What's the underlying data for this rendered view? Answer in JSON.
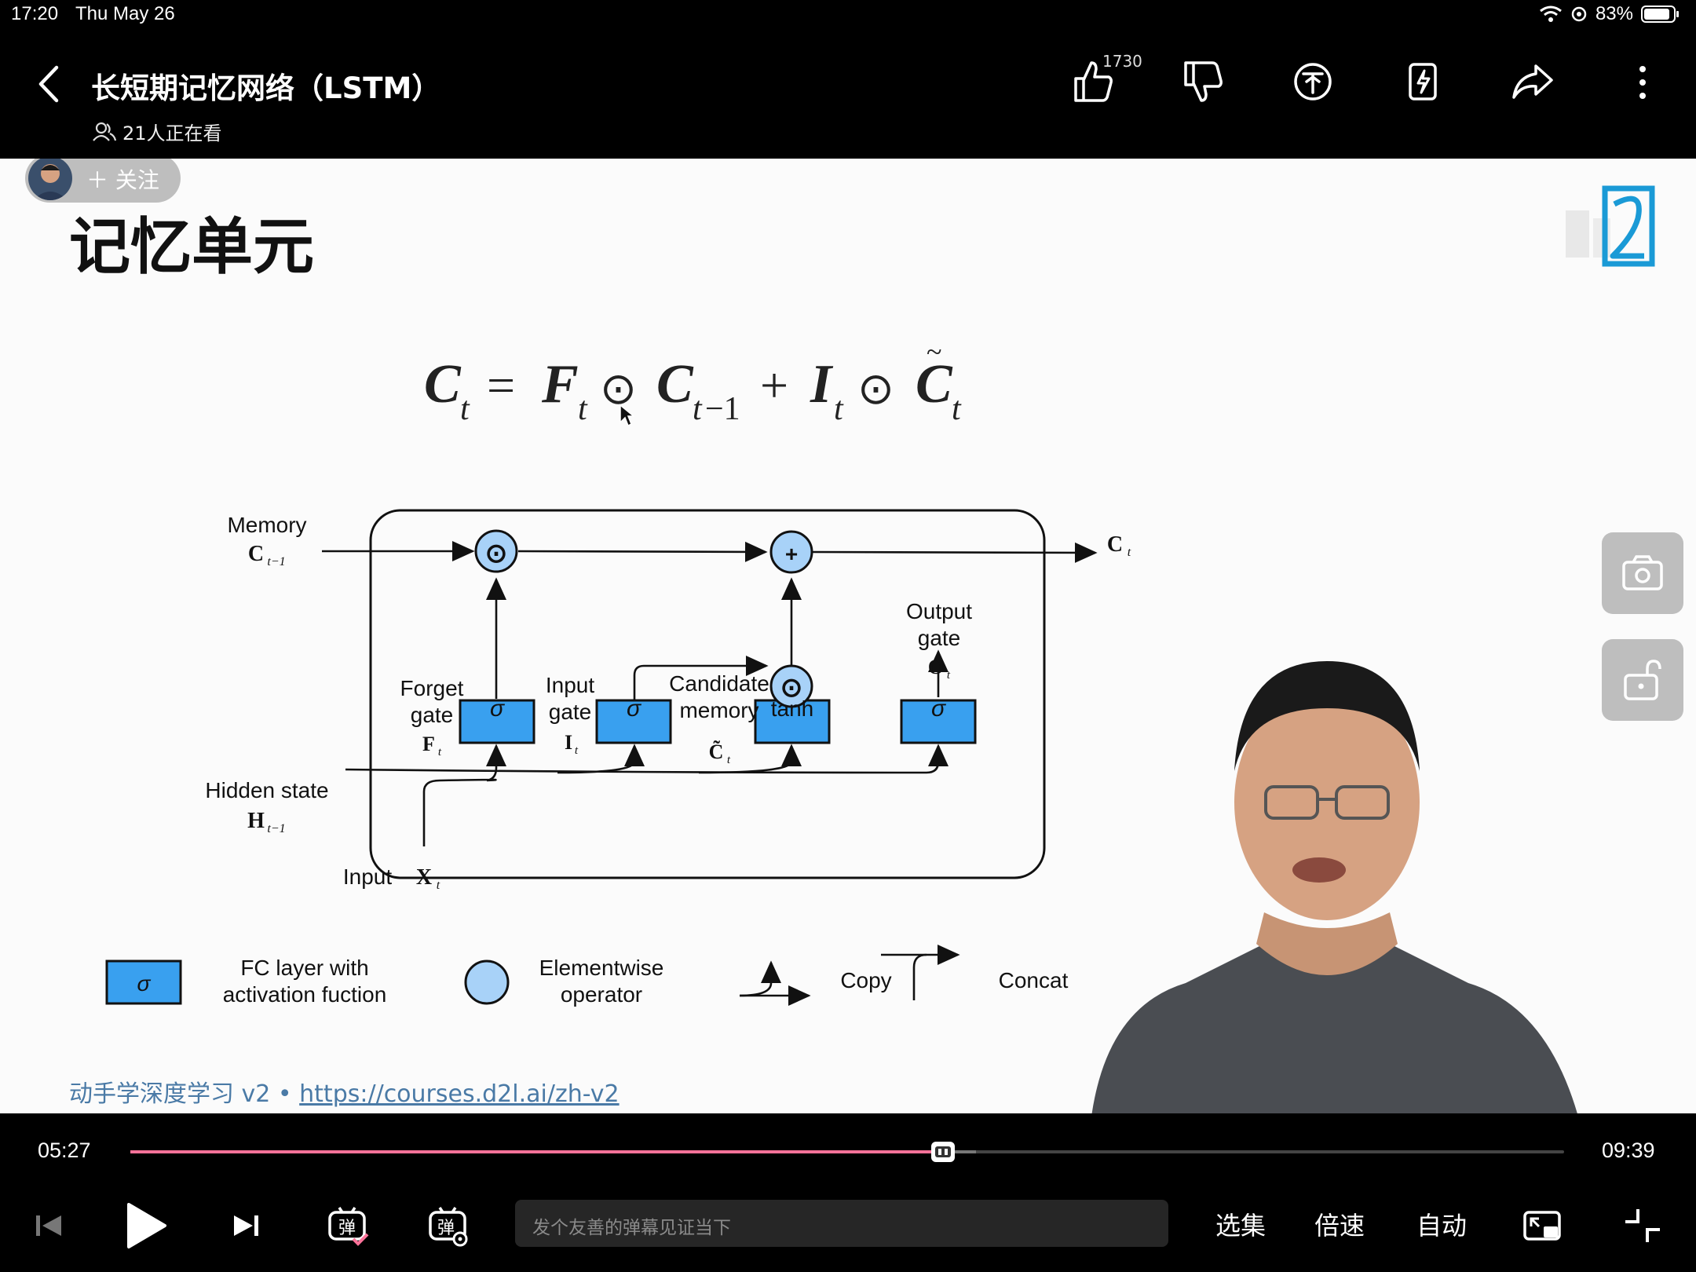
{
  "status_bar": {
    "time": "17:20",
    "date": "Thu May 26",
    "battery": "83%"
  },
  "header": {
    "title": "长短期记忆网络（LSTM）",
    "viewers": "21人正在看",
    "like_count": "1730"
  },
  "actions": [
    {
      "icon": "thumb-up-icon"
    },
    {
      "icon": "thumb-down-icon"
    },
    {
      "icon": "coin-icon"
    },
    {
      "icon": "favorite-icon"
    },
    {
      "icon": "share-icon"
    },
    {
      "icon": "more-icon"
    }
  ],
  "follow": {
    "label": "＋ 关注"
  },
  "slide": {
    "title": "记忆单元",
    "diagram": {
      "memory_label": "Memory",
      "c_prev": "C",
      "c_prev_sub": "t−1",
      "c_t": "C",
      "c_t_sub": "t",
      "hidden_state_label": "Hidden state",
      "h_prev": "H",
      "h_prev_sub": "t−1",
      "input_label": "Input",
      "x_t": "X",
      "x_t_sub": "t",
      "forget_gate_l1": "Forget",
      "forget_gate_l2": "gate",
      "f_sym": "F",
      "input_gate_l1": "Input",
      "input_gate_l2": "gate",
      "i_sym": "I",
      "candidate_l1": "Candidate",
      "candidate_l2": "memory",
      "c_tilde": "C̃",
      "output_gate_l1": "Output",
      "output_gate_l2": "gate",
      "o_sym": "O",
      "sub_t": "t",
      "sigma": "σ",
      "tanh": "tanh",
      "odot": "⊙",
      "plus": "+"
    },
    "legend": {
      "fc_sigma": "σ",
      "fc_l1": "FC layer with",
      "fc_l2": "activation fuction",
      "elem_l1": "Elementwise",
      "elem_l2": "operator",
      "copy": "Copy",
      "concat": "Concat"
    },
    "footer_text": "动手学深度学习 v2 • ",
    "footer_url": "https://courses.d2l.ai/zh-v2"
  },
  "player": {
    "current_time": "05:27",
    "total_time": "09:39",
    "progress": 0.567,
    "buffered": 0.59,
    "danmaku_placeholder": "发个友善的弹幕见证当下",
    "episodes": "选集",
    "speed": "倍速",
    "auto": "自动",
    "accent": "#fb7299"
  }
}
